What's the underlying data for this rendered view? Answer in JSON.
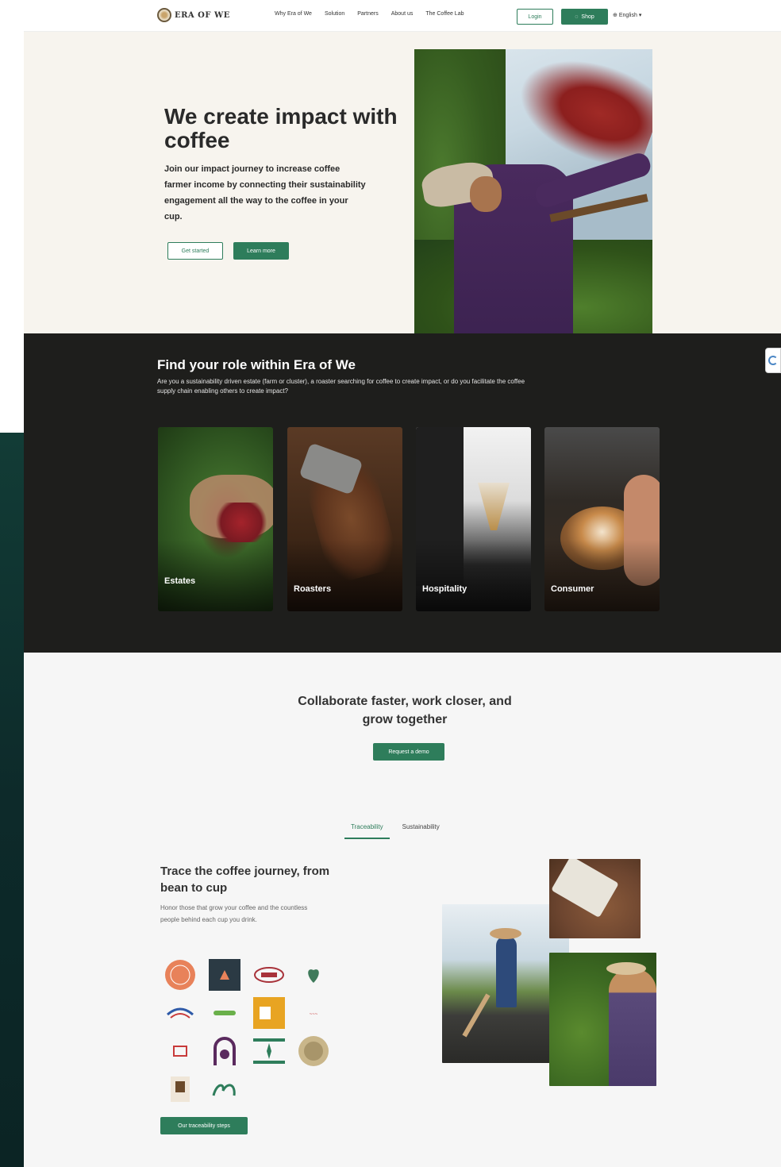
{
  "nav": {
    "logo_text": "ERA OF WE",
    "links": [
      "Why Era of We",
      "Solution",
      "Partners",
      "About us",
      "The Coffee Lab"
    ],
    "login_label": "Login",
    "shop_label": "Shop",
    "language_label": "English"
  },
  "hero": {
    "title": "We create impact with coffee",
    "subtitle": "Join our impact journey to increase coffee farmer income by connecting their sustainability engagement all the way to the coffee in your cup.",
    "get_started_label": "Get started",
    "learn_more_label": "Learn more"
  },
  "roles": {
    "title": "Find your role within Era of We",
    "subtitle": "Are you a sustainability driven estate (farm or cluster), a roaster searching for coffee to create impact, or do you facilitate the coffee supply chain enabling others to create impact?",
    "cards": [
      {
        "label": "Estates"
      },
      {
        "label": "Roasters"
      },
      {
        "label": "Hospitality"
      },
      {
        "label": "Consumer"
      }
    ]
  },
  "collaborate": {
    "title": "Collaborate faster, work closer, and grow together",
    "demo_label": "Request a demo"
  },
  "tabs": {
    "items": [
      {
        "label": "Traceability",
        "active": true
      },
      {
        "label": "Sustainability",
        "active": false
      }
    ]
  },
  "trace": {
    "title": "Trace the coffee journey, from bean to cup",
    "subtitle": "Honor those that grow your coffee and the countless people behind each cup you drink.",
    "button_label": "Our traceability steps"
  },
  "colors": {
    "brand_green": "#2e7d5b",
    "hero_bg": "#f7f4ee",
    "dark_section_bg": "#1e1e1c"
  }
}
